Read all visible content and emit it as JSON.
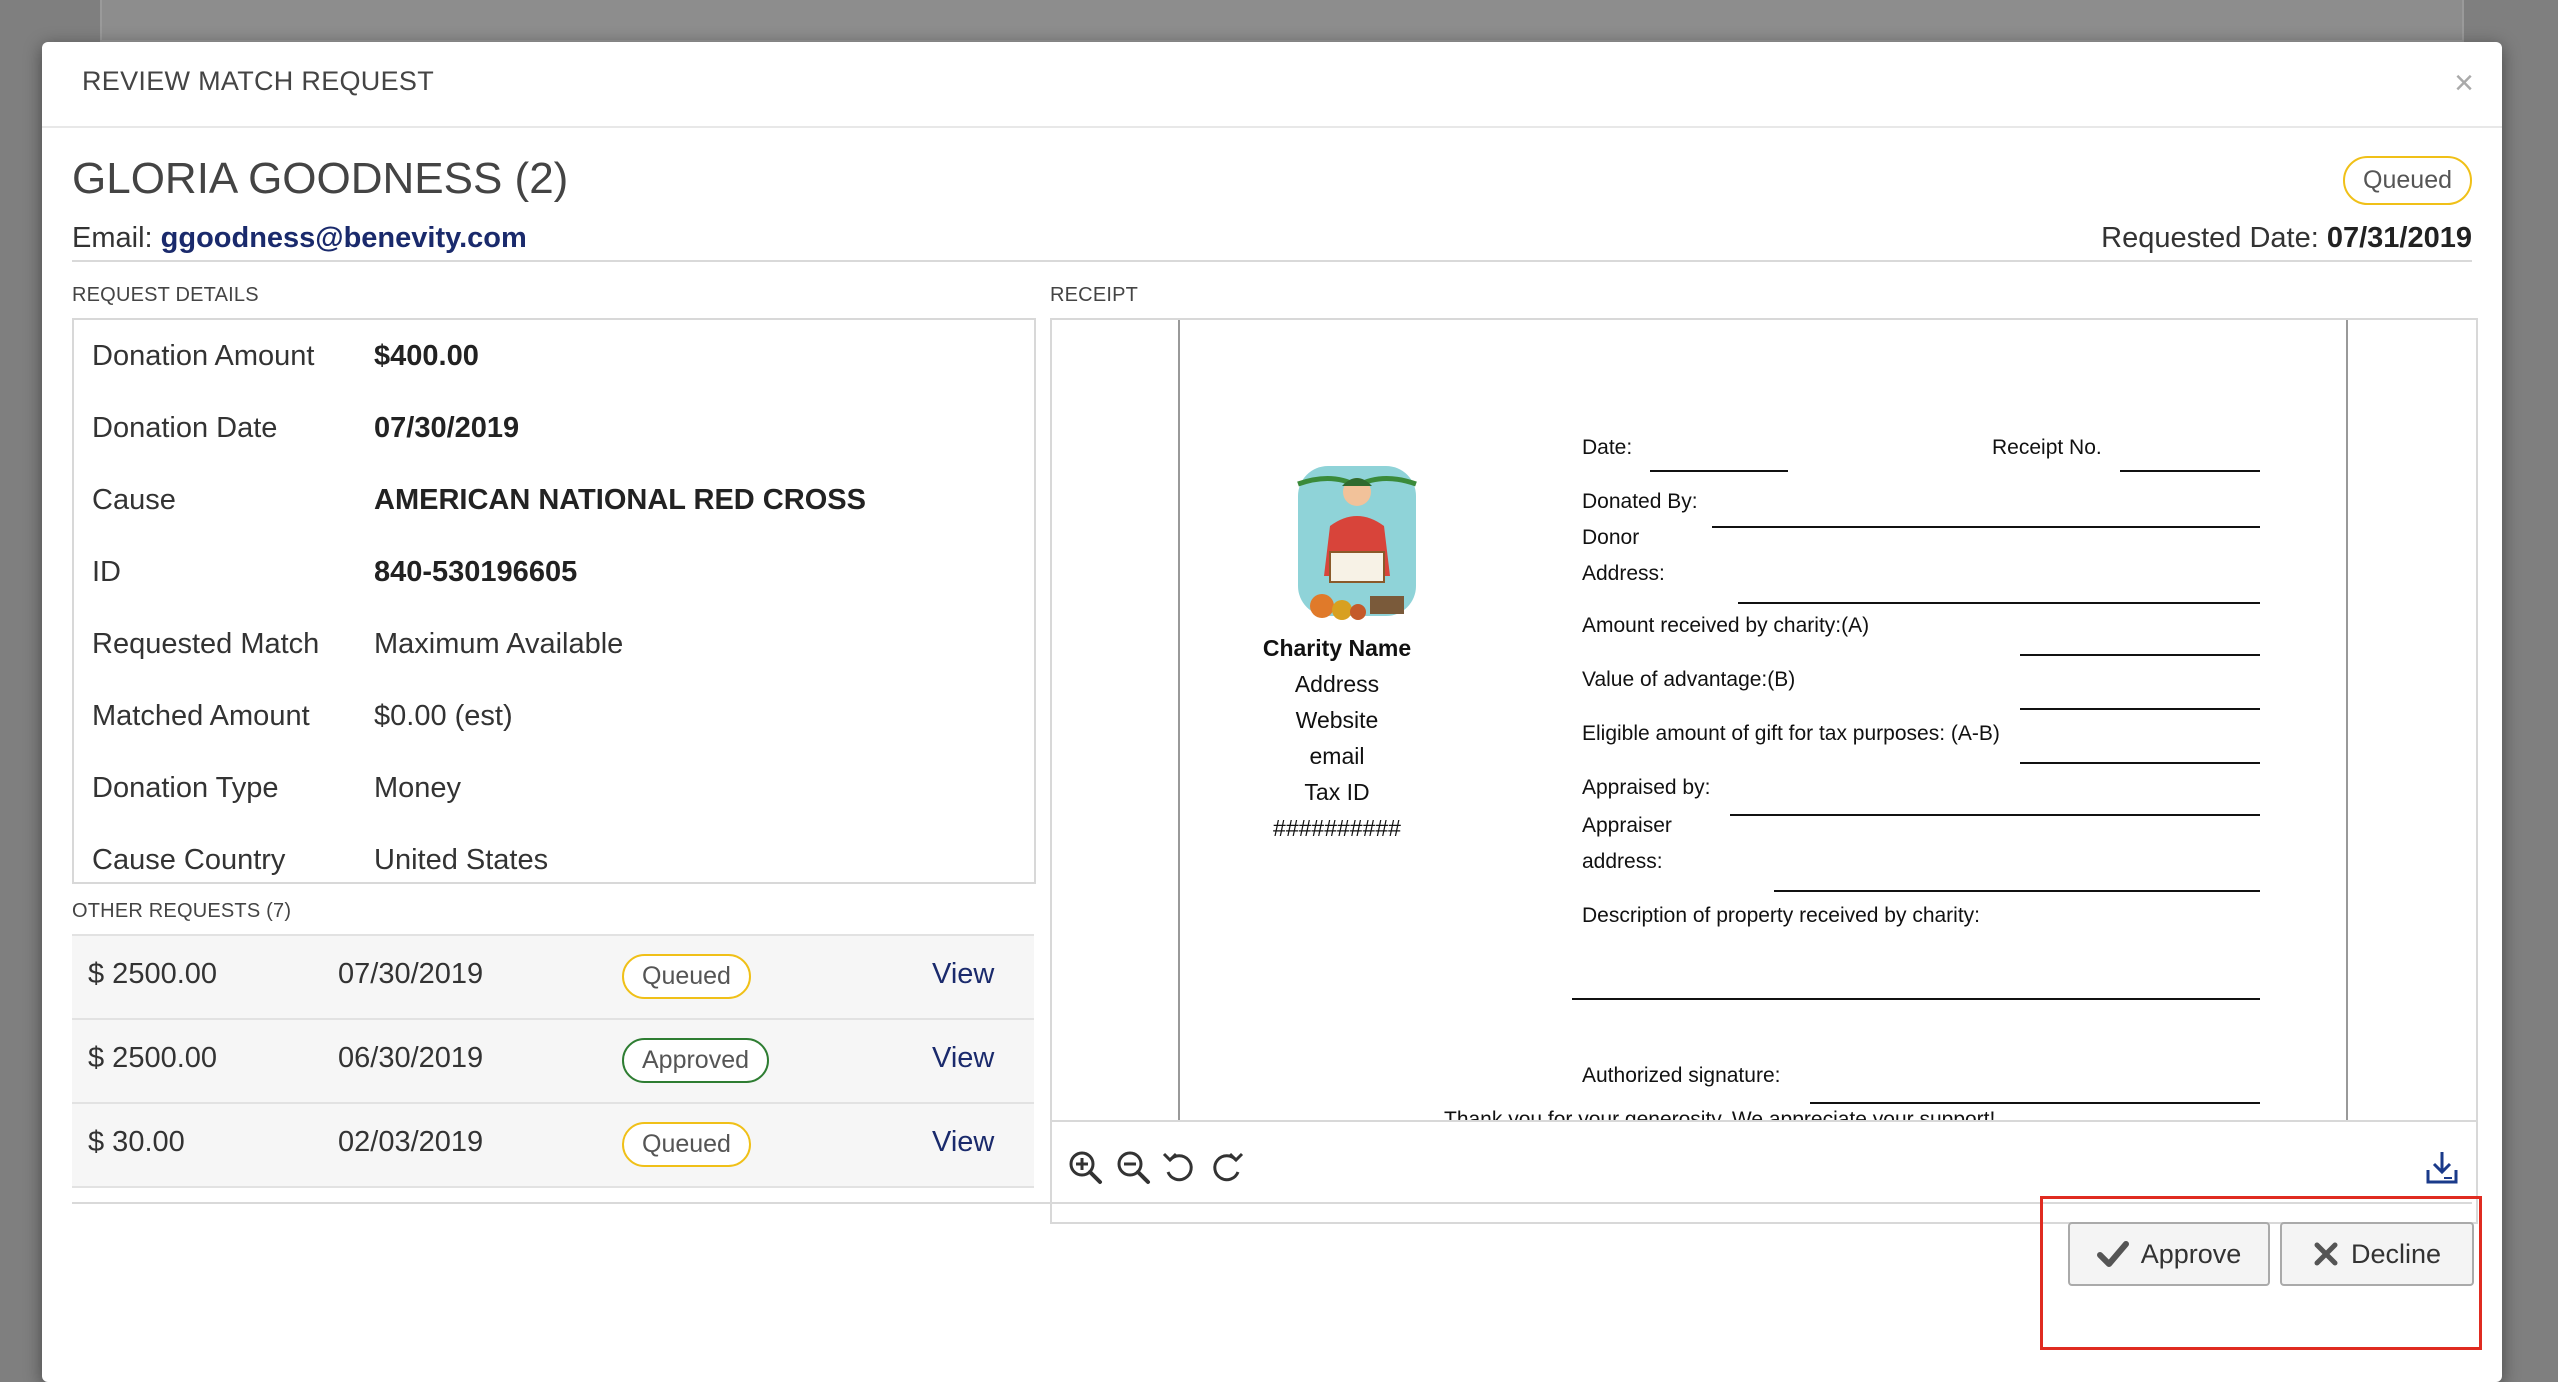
{
  "modal": {
    "title": "REVIEW MATCH REQUEST",
    "close_label": "×"
  },
  "person": {
    "name": "GLORIA GOODNESS (2)",
    "status": "Queued",
    "email_label": "Email:",
    "email": "ggoodness@benevity.com",
    "requested_date_label": "Requested Date:",
    "requested_date": "07/31/2019"
  },
  "request_details": {
    "section_label": "REQUEST DETAILS",
    "rows": [
      {
        "label": "Donation Amount",
        "value": "$400.00"
      },
      {
        "label": "Donation Date",
        "value": "07/30/2019"
      },
      {
        "label": "Cause",
        "value": "AMERICAN NATIONAL RED CROSS"
      },
      {
        "label": "ID",
        "value": "840-530196605"
      },
      {
        "label": "Requested Match",
        "value": "Maximum Available"
      },
      {
        "label": "Matched Amount",
        "value": "$0.00 (est)"
      },
      {
        "label": "Donation Type",
        "value": "Money"
      },
      {
        "label": "Cause Country",
        "value": "United States"
      }
    ]
  },
  "other_requests": {
    "section_label": "OTHER REQUESTS (7)",
    "view_label": "View",
    "rows": [
      {
        "amount": "$ 2500.00",
        "date": "07/30/2019",
        "status": "Queued"
      },
      {
        "amount": "$ 2500.00",
        "date": "06/30/2019",
        "status": "Approved"
      },
      {
        "amount": "$ 30.00",
        "date": "02/03/2019",
        "status": "Queued"
      }
    ]
  },
  "receipt": {
    "section_label": "RECEIPT",
    "charity": {
      "name": "Charity Name",
      "address": "Address",
      "website": "Website",
      "email": "email",
      "tax_id": "Tax ID ##########"
    },
    "fields": {
      "date": "Date:",
      "receipt_no": "Receipt No.",
      "donated_by": "Donated By:",
      "donor": "Donor",
      "address": "Address:",
      "amount_received": "Amount received by charity:(A)",
      "value_of_advantage": "Value of advantage:(B)",
      "eligible_amount": "Eligible amount of gift for tax purposes: (A-B)",
      "appraised_by": "Appraised by:",
      "appraiser": "Appraiser",
      "appraiser_address": "address:",
      "description": "Description of property received by charity:",
      "authorized_signature": "Authorized signature:",
      "thank_you": "Thank you for your generosity. We appreciate your support!"
    },
    "toolbar": {
      "icons": [
        "zoom-in-icon",
        "zoom-out-icon",
        "rotate-left-icon",
        "rotate-right-icon",
        "download-icon"
      ]
    }
  },
  "actions": {
    "approve_label": "Approve",
    "decline_label": "Decline"
  },
  "colors": {
    "queued": "#f0c018",
    "approved": "#2e7d32",
    "link": "#1a2a6c",
    "highlight": "#e02b20"
  }
}
